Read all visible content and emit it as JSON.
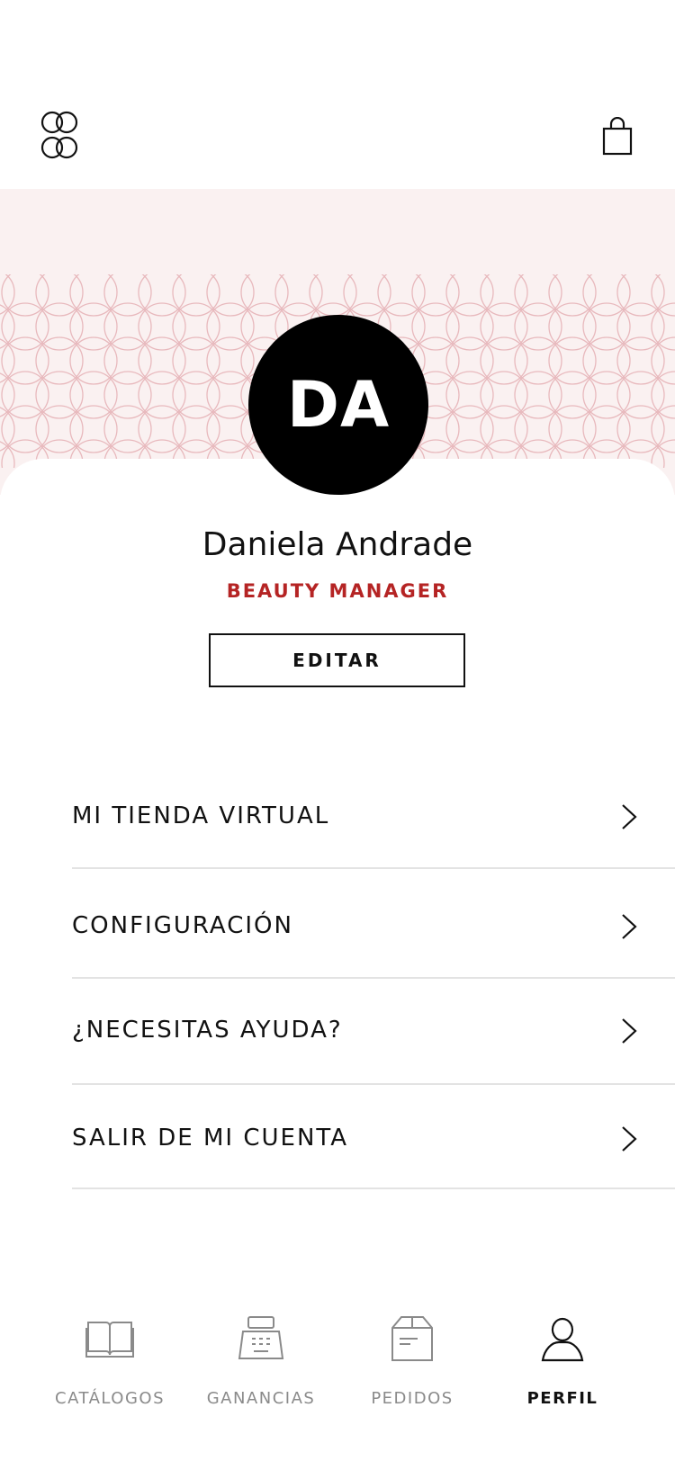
{
  "header": {
    "logo_icon": "brand-logo-icon",
    "cart_icon": "shopping-bag-icon"
  },
  "profile": {
    "initials": "DA",
    "name": "Daniela Andrade",
    "role": "BEAUTY MANAGER",
    "edit_label": "EDITAR"
  },
  "menu": {
    "items": [
      {
        "label": "MI TIENDA VIRTUAL",
        "icon": "chevron-right-icon"
      },
      {
        "label": "CONFIGURACIÓN",
        "icon": "chevron-right-icon"
      },
      {
        "label": "¿NECESITAS AYUDA?",
        "icon": "chevron-right-icon"
      },
      {
        "label": "SALIR DE MI CUENTA",
        "icon": "chevron-right-icon"
      }
    ]
  },
  "tabbar": {
    "tabs": [
      {
        "label": "CATÁLOGOS",
        "icon": "book-icon",
        "active": false
      },
      {
        "label": "GANANCIAS",
        "icon": "cash-register-icon",
        "active": false
      },
      {
        "label": "PEDIDOS",
        "icon": "box-icon",
        "active": false
      },
      {
        "label": "PERFIL",
        "icon": "user-icon",
        "active": true
      }
    ]
  },
  "colors": {
    "accent_role": "#b52424",
    "hero_bg": "#faf1f1",
    "pattern_stroke": "#e8b9bd"
  }
}
